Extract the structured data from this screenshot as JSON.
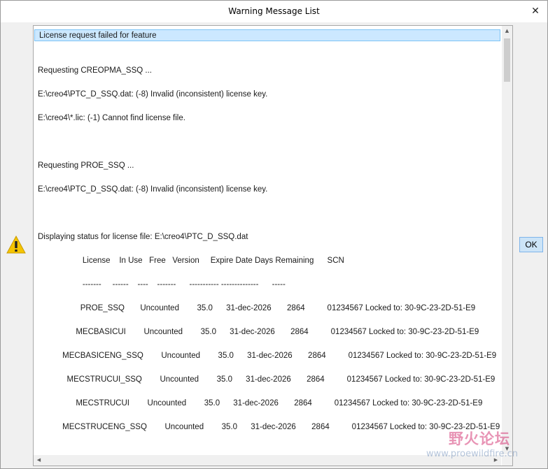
{
  "window": {
    "title": "Warning Message List",
    "close_glyph": "✕"
  },
  "icons": {
    "warning": "warning-triangle-icon",
    "close": "close-icon"
  },
  "colors": {
    "selection_bg": "#cce8ff",
    "selection_border": "#7ec4f5",
    "ok_button_bg": "#cce4f7",
    "warning_yellow": "#f5c400"
  },
  "messages": [
    "License request failed for feature",
    "",
    "",
    "Requesting CREOPMA_SSQ ...",
    "",
    "E:\\creo4\\PTC_D_SSQ.dat: (-8) Invalid (inconsistent) license key.",
    "",
    "E:\\creo4\\*.lic: (-1) Cannot find license file.",
    "",
    "",
    "",
    "Requesting PROE_SSQ ...",
    "",
    "E:\\creo4\\PTC_D_SSQ.dat: (-8) Invalid (inconsistent) license key.",
    "",
    "",
    "",
    "Displaying status for license file: E:\\creo4\\PTC_D_SSQ.dat",
    "",
    "                    License    In Use   Free   Version     Expire Date Days Remaining      SCN",
    "",
    "                    -------     ------    ----    -------      ----------- --------------      -----",
    "",
    "                   PROE_SSQ       Uncounted        35.0      31-dec-2026       2864          01234567 Locked to: 30-9C-23-2D-51-E9",
    "",
    "                 MECBASICUI        Uncounted        35.0      31-dec-2026       2864          01234567 Locked to: 30-9C-23-2D-51-E9",
    "",
    "           MECBASICENG_SSQ        Uncounted        35.0      31-dec-2026       2864          01234567 Locked to: 30-9C-23-2D-51-E9",
    "",
    "             MECSTRUCUI_SSQ        Uncounted        35.0      31-dec-2026       2864          01234567 Locked to: 30-9C-23-2D-51-E9",
    "",
    "                 MECSTRUCUI        Uncounted        35.0      31-dec-2026       2864          01234567 Locked to: 30-9C-23-2D-51-E9",
    "",
    "           MECSTRUCENG_SSQ        Uncounted        35.0      31-dec-2026       2864          01234567 Locked to: 30-9C-23-2D-51-E9",
    "",
    ""
  ],
  "buttons": {
    "ok": "OK"
  },
  "watermark": {
    "text": "野火论坛",
    "url": "www.proewildfire.cn"
  }
}
